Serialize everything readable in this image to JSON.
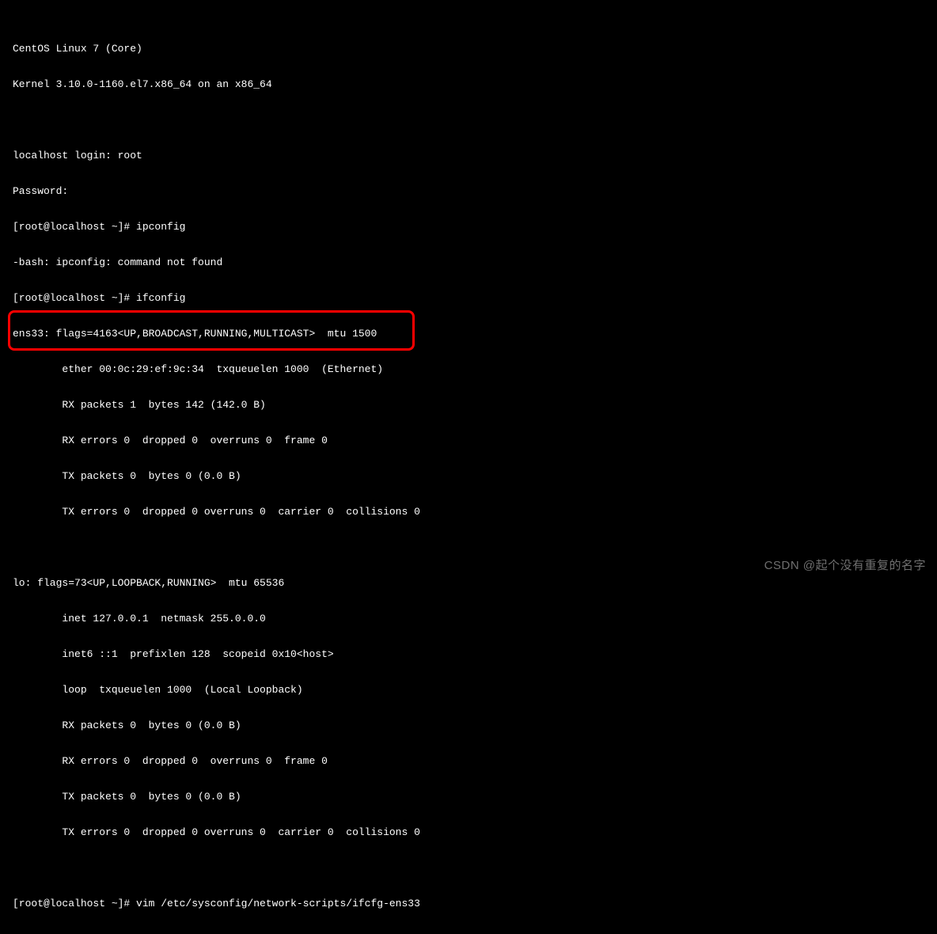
{
  "terminal": {
    "lines": [
      "CentOS Linux 7 (Core)",
      "Kernel 3.10.0-1160.el7.x86_64 on an x86_64",
      "",
      "localhost login: root",
      "Password:",
      "[root@localhost ~]# ipconfig",
      "-bash: ipconfig: command not found",
      "[root@localhost ~]# ifconfig",
      "ens33: flags=4163<UP,BROADCAST,RUNNING,MULTICAST>  mtu 1500",
      "        ether 00:0c:29:ef:9c:34  txqueuelen 1000  (Ethernet)",
      "        RX packets 1  bytes 142 (142.0 B)",
      "        RX errors 0  dropped 0  overruns 0  frame 0",
      "        TX packets 0  bytes 0 (0.0 B)",
      "        TX errors 0  dropped 0 overruns 0  carrier 0  collisions 0",
      "",
      "lo: flags=73<UP,LOOPBACK,RUNNING>  mtu 65536",
      "        inet 127.0.0.1  netmask 255.0.0.0",
      "        inet6 ::1  prefixlen 128  scopeid 0x10<host>",
      "        loop  txqueuelen 1000  (Local Loopback)",
      "        RX packets 0  bytes 0 (0.0 B)",
      "        RX errors 0  dropped 0  overruns 0  frame 0",
      "        TX packets 0  bytes 0 (0.0 B)",
      "        TX errors 0  dropped 0 overruns 0  carrier 0  collisions 0",
      "",
      "[root@localhost ~]# vim /etc/sysconfig/network-scripts/ifcfg-ens33"
    ]
  },
  "watermark": "CSDN @起个没有重复的名字"
}
